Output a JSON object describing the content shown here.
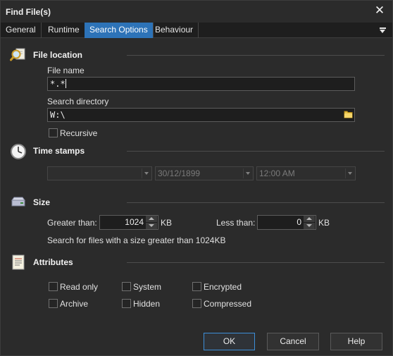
{
  "window": {
    "title": "Find File(s)",
    "close_glyph": "✕"
  },
  "tabs": [
    {
      "label": "General",
      "active": false
    },
    {
      "label": "Runtime",
      "active": false
    },
    {
      "label": "Search Options",
      "active": true
    },
    {
      "label": "Behaviour",
      "active": false
    }
  ],
  "file_location": {
    "title": "File location",
    "icon": "magnifier-file-icon",
    "file_name_label": "File name",
    "file_name_value": "*.*",
    "search_dir_label": "Search directory",
    "search_dir_value": "W:\\",
    "browse_icon": "folder-icon",
    "recursive_label": "Recursive",
    "recursive_checked": false
  },
  "time_stamps": {
    "title": "Time stamps",
    "icon": "clock-icon",
    "type_value": "",
    "date_value": "30/12/1899",
    "time_value": "12:00 AM"
  },
  "size": {
    "title": "Size",
    "icon": "drive-icon",
    "greater_label": "Greater than:",
    "greater_value": "1024",
    "greater_unit": "KB",
    "less_label": "Less than:",
    "less_value": "0",
    "less_unit": "KB",
    "summary": "Search for files with a size greater than 1024KB"
  },
  "attributes": {
    "title": "Attributes",
    "icon": "document-list-icon",
    "read_only": "Read only",
    "system": "System",
    "encrypted": "Encrypted",
    "archive": "Archive",
    "hidden": "Hidden",
    "compressed": "Compressed"
  },
  "buttons": {
    "ok": "OK",
    "cancel": "Cancel",
    "help": "Help"
  },
  "colors": {
    "accent": "#2d73b8",
    "background": "#2b2b2b",
    "field": "#1e1e1e",
    "default_border": "#3d8fd8"
  }
}
